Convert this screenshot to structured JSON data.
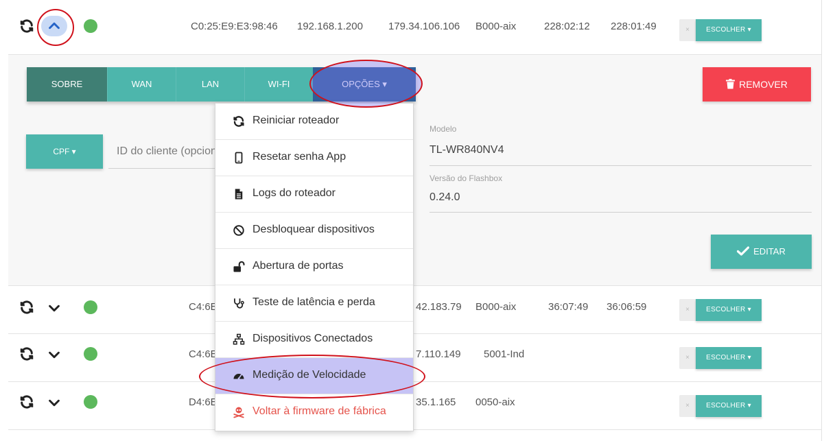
{
  "rows": [
    {
      "mac": "C0:25:E9:E3:98:46",
      "ip_local": "192.168.1.200",
      "ip_public": "179.34.106.106",
      "pop": "B000-aix",
      "uptime1": "228:02:12",
      "uptime2": "228:01:49"
    },
    {
      "mac": "C4:6E",
      "ip_public": "42.183.79",
      "pop": "B000-aix",
      "uptime1": "36:07:49",
      "uptime2": "36:06:59"
    },
    {
      "mac": "C4:6E",
      "ip_public": "7.110.149",
      "pop": "5001-Ind"
    },
    {
      "mac": "D4:6E",
      "ip_public": "35.1.165",
      "pop": "0050-aix"
    }
  ],
  "choose_label": "ESCOLHER ▾",
  "choose_clear": "×",
  "tabs": [
    "SOBRE",
    "WAN",
    "LAN",
    "WI-FI",
    "OPÇÕES ▾"
  ],
  "remove_label": "REMOVER",
  "cpf_label": "CPF ▾",
  "client_id_placeholder": "ID do cliente (opcional)",
  "model": {
    "label": "Modelo",
    "value": "TL-WR840NV4"
  },
  "flashbox": {
    "label": "Versão do Flashbox",
    "value": "0.24.0"
  },
  "edit_label": "EDITAR",
  "menu": [
    {
      "label": "Reiniciar roteador",
      "icon": "sync-icon"
    },
    {
      "label": "Resetar senha App",
      "icon": "mobile-icon"
    },
    {
      "label": "Logs do roteador",
      "icon": "file-icon"
    },
    {
      "label": "Desbloquear dispositivos",
      "icon": "ban-icon"
    },
    {
      "label": "Abertura de portas",
      "icon": "unlock-icon"
    },
    {
      "label": "Teste de latência e perda",
      "icon": "stethoscope-icon"
    },
    {
      "label": "Dispositivos Conectados",
      "icon": "sitemap-icon"
    },
    {
      "label": "Medição de Velocidade",
      "icon": "tachometer-icon"
    },
    {
      "label": "Voltar à firmware de fábrica",
      "icon": "skull-crossbones-icon"
    }
  ],
  "colors": {
    "teal": "#4db6ac",
    "teal_dark": "#3f7f74",
    "navy": "#2f5f99",
    "red": "#f4424f",
    "green": "#5cb85c",
    "annotation": "#d0111b",
    "highlight": "#c6c3f5"
  }
}
